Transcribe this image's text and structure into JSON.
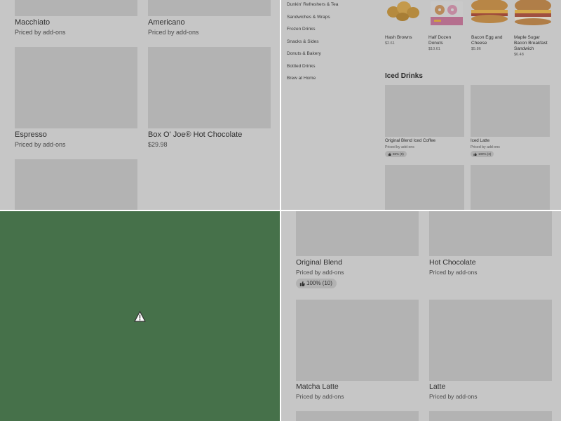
{
  "top_left": {
    "items": [
      {
        "name": "Macchiato",
        "price": "Priced by add-ons"
      },
      {
        "name": "Americano",
        "price": "Priced by add-ons"
      },
      {
        "name": "Espresso",
        "price": "Priced by add-ons"
      },
      {
        "name": "Box O' Joe® Hot Chocolate",
        "price": "$29.98"
      }
    ]
  },
  "top_right": {
    "categories": [
      "Dunkin' Refreshers & Tea",
      "Sandwiches & Wraps",
      "Frozen Drinks",
      "Snacks & Sides",
      "Donuts & Bakery",
      "Bottled Drinks",
      "Brew at Home"
    ],
    "featured": [
      {
        "name": "Hash Browns",
        "price": "$2.61"
      },
      {
        "name": "Half Dozen Donuts",
        "price": "$10.61"
      },
      {
        "name": "Bacon Egg and Cheese",
        "price": "$5.86"
      },
      {
        "name": "Maple Sugar Bacon Breakfast Sandwich",
        "price": "$6.48"
      }
    ],
    "section_title": "Iced Drinks",
    "iced": [
      {
        "name": "Original Blend Iced Coffee",
        "price": "Priced by add-ons",
        "rating": "86% (9)"
      },
      {
        "name": "Iced Latte",
        "price": "Priced by add-ons",
        "rating": "100% (3)"
      }
    ]
  },
  "bottom_left": {
    "icon": "warning-icon",
    "bg_color": "#46714a"
  },
  "bottom_right": {
    "items": [
      {
        "name": "Original Blend",
        "price": "Priced by add-ons",
        "rating": "100% (10)"
      },
      {
        "name": "Hot Chocolate",
        "price": "Priced by add-ons"
      },
      {
        "name": "Matcha Latte",
        "price": "Priced by add-ons"
      },
      {
        "name": "Latte",
        "price": "Priced by add-ons"
      }
    ]
  }
}
